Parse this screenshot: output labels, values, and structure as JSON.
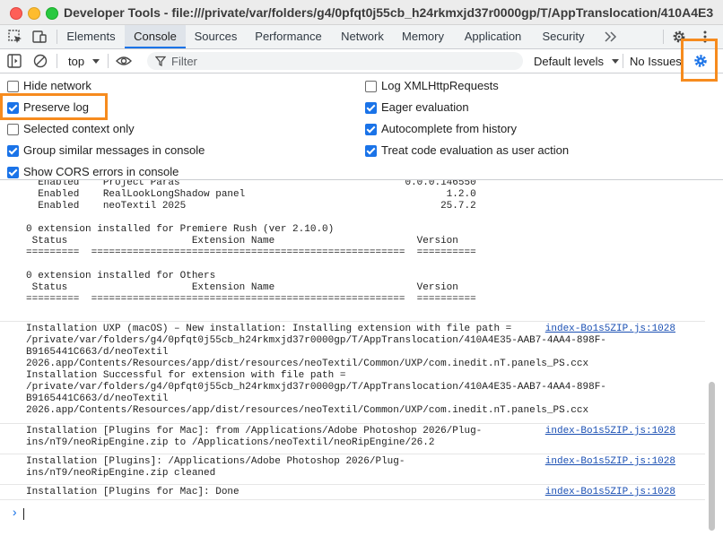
{
  "window": {
    "title": "Developer Tools - file:///private/var/folders/g4/0pfqt0j55cb_h24rkmxjd37r0000gp/T/AppTranslocation/410A4E3..."
  },
  "tabs": [
    {
      "label": "Elements",
      "active": false
    },
    {
      "label": "Console",
      "active": true
    },
    {
      "label": "Sources",
      "active": false
    },
    {
      "label": "Performance",
      "active": false
    },
    {
      "label": "Network",
      "active": false
    },
    {
      "label": "Memory",
      "active": false
    },
    {
      "label": "Application",
      "active": false
    },
    {
      "label": "Security",
      "active": false
    }
  ],
  "toolbar": {
    "context": "top",
    "filter_placeholder": "Filter",
    "levels": "Default levels",
    "issues": "No Issues"
  },
  "settings": {
    "left": [
      {
        "label": "Hide network",
        "checked": false
      },
      {
        "label": "Preserve log",
        "checked": true
      },
      {
        "label": "Selected context only",
        "checked": false
      },
      {
        "label": "Group similar messages in console",
        "checked": true
      },
      {
        "label": "Show CORS errors in console",
        "checked": true
      }
    ],
    "right": [
      {
        "label": "Log XMLHttpRequests",
        "checked": false
      },
      {
        "label": "Eager evaluation",
        "checked": true
      },
      {
        "label": "Autocomplete from history",
        "checked": true
      },
      {
        "label": "Treat code evaluation as user action",
        "checked": true
      }
    ]
  },
  "console": {
    "extension_table": "  Enabled    Project Paras                                      0.0.0.146550\n  Enabled    RealLookLongShadow panel                                  1.2.0\n  Enabled    neoTextil 2025                                           25.7.2\n\n0 extension installed for Premiere Rush (ver 2.10.0)\n Status                     Extension Name                        Version\n=========  =====================================================  ==========\n\n0 extension installed for Others\n Status                     Extension Name                        Version\n=========  =====================================================  ==========",
    "messages": [
      {
        "text": "Installation UXP (macOS) – New installation: Installing extension with file path =\n/private/var/folders/g4/0pfqt0j55cb_h24rkmxjd37r0000gp/T/AppTranslocation/410A4E35-AAB7-4AA4-898F-\nB9165441C663/d/neoTextil\n2026.app/Contents/Resources/app/dist/resources/neoTextil/Common/UXP/com.inedit.nT.panels_PS.ccx\nInstallation Successful for extension with file path =\n/private/var/folders/g4/0pfqt0j55cb_h24rkmxjd37r0000gp/T/AppTranslocation/410A4E35-AAB7-4AA4-898F-\nB9165441C663/d/neoTextil\n2026.app/Contents/Resources/app/dist/resources/neoTextil/Common/UXP/com.inedit.nT.panels_PS.ccx",
        "source": "index-Bo1s5ZIP.js:1028"
      },
      {
        "text": "Installation [Plugins for Mac]: from /Applications/Adobe Photoshop 2026/Plug-\nins/nT9/neoRipEngine.zip to /Applications/neoTextil/neoRipEngine/26.2",
        "source": "index-Bo1s5ZIP.js:1028"
      },
      {
        "text": "Installation [Plugins]: /Applications/Adobe Photoshop 2026/Plug-\nins/nT9/neoRipEngine.zip cleaned",
        "source": "index-Bo1s5ZIP.js:1028"
      },
      {
        "text": "Installation [Plugins for Mac]: Done",
        "source": "index-Bo1s5ZIP.js:1028"
      }
    ],
    "prompt": "›"
  },
  "colors": {
    "accent": "#1a73e8",
    "highlight": "#f68b1e"
  },
  "icons": [
    "inspect-element-icon",
    "device-toolbar-icon",
    "more-tabs-icon",
    "gear-icon",
    "kebab-menu-icon",
    "sidebar-toggle-icon",
    "clear-console-icon",
    "eye-icon",
    "filter-icon",
    "dropdown-caret-icon"
  ]
}
